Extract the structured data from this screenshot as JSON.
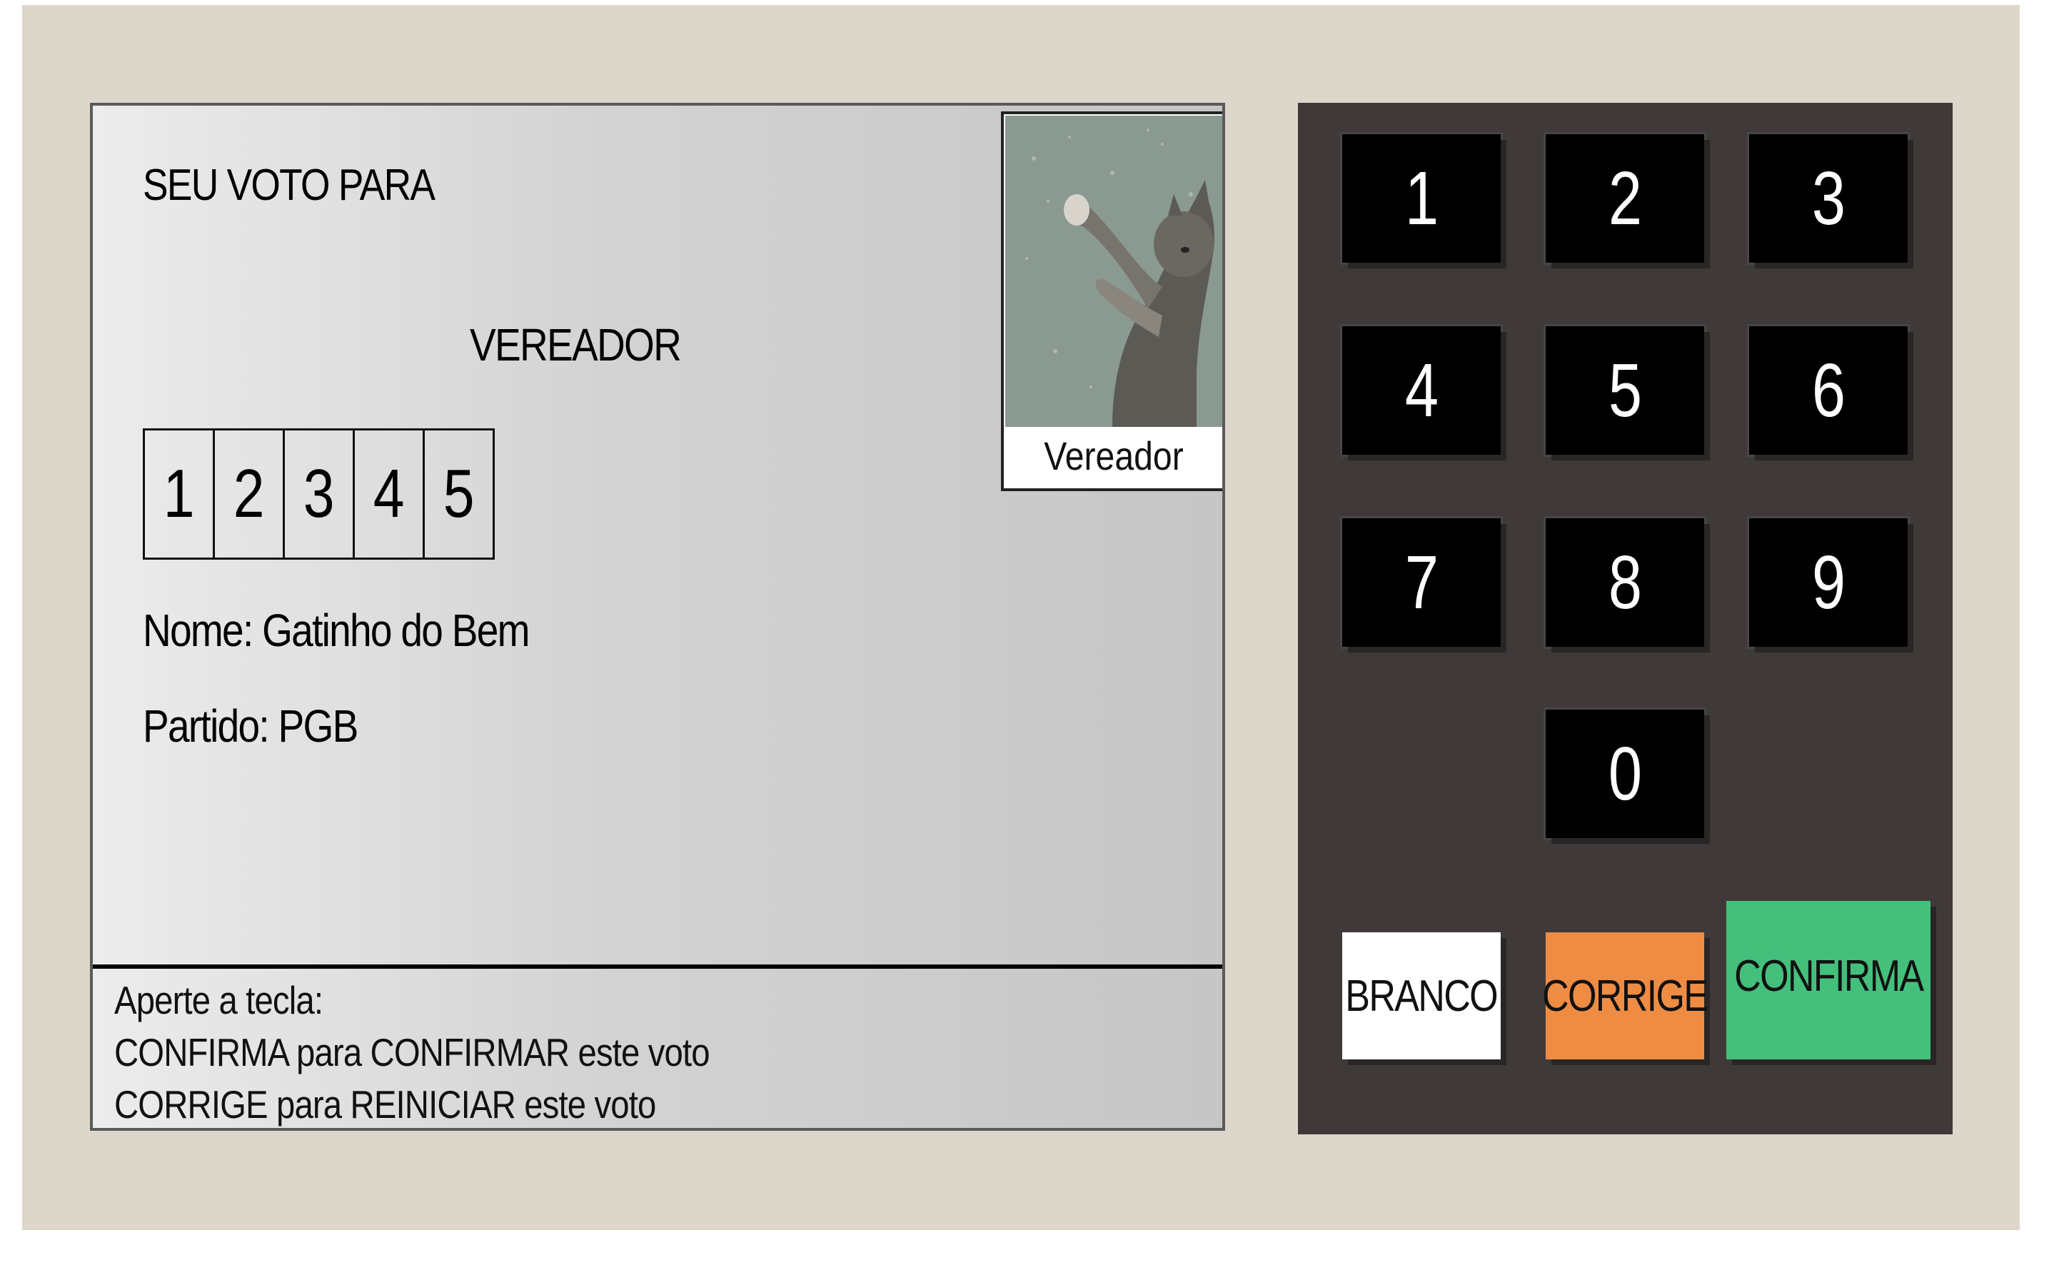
{
  "screen": {
    "heading": "SEU VOTO PARA",
    "office": "VEREADOR",
    "digits": [
      "1",
      "2",
      "3",
      "4",
      "5"
    ],
    "name_line": "Nome: Gatinho do Bem",
    "party_line": "Partido: PGB",
    "photo_caption": "Vereador",
    "instructions": [
      "Aperte a tecla:",
      "CONFIRMA para CONFIRMAR este voto",
      "CORRIGE para REINICIAR este voto"
    ]
  },
  "keypad": {
    "keys": [
      "1",
      "2",
      "3",
      "4",
      "5",
      "6",
      "7",
      "8",
      "9",
      "0"
    ],
    "branco_label": "BRANCO",
    "corrige_label": "CORRIGE",
    "confirma_label": "CONFIRMA"
  },
  "colors": {
    "background": "#ddd7cb",
    "keypad": "#3f3a39",
    "branco": "#ffffff",
    "corrige": "#ef8c44",
    "confirma": "#44c07c"
  }
}
